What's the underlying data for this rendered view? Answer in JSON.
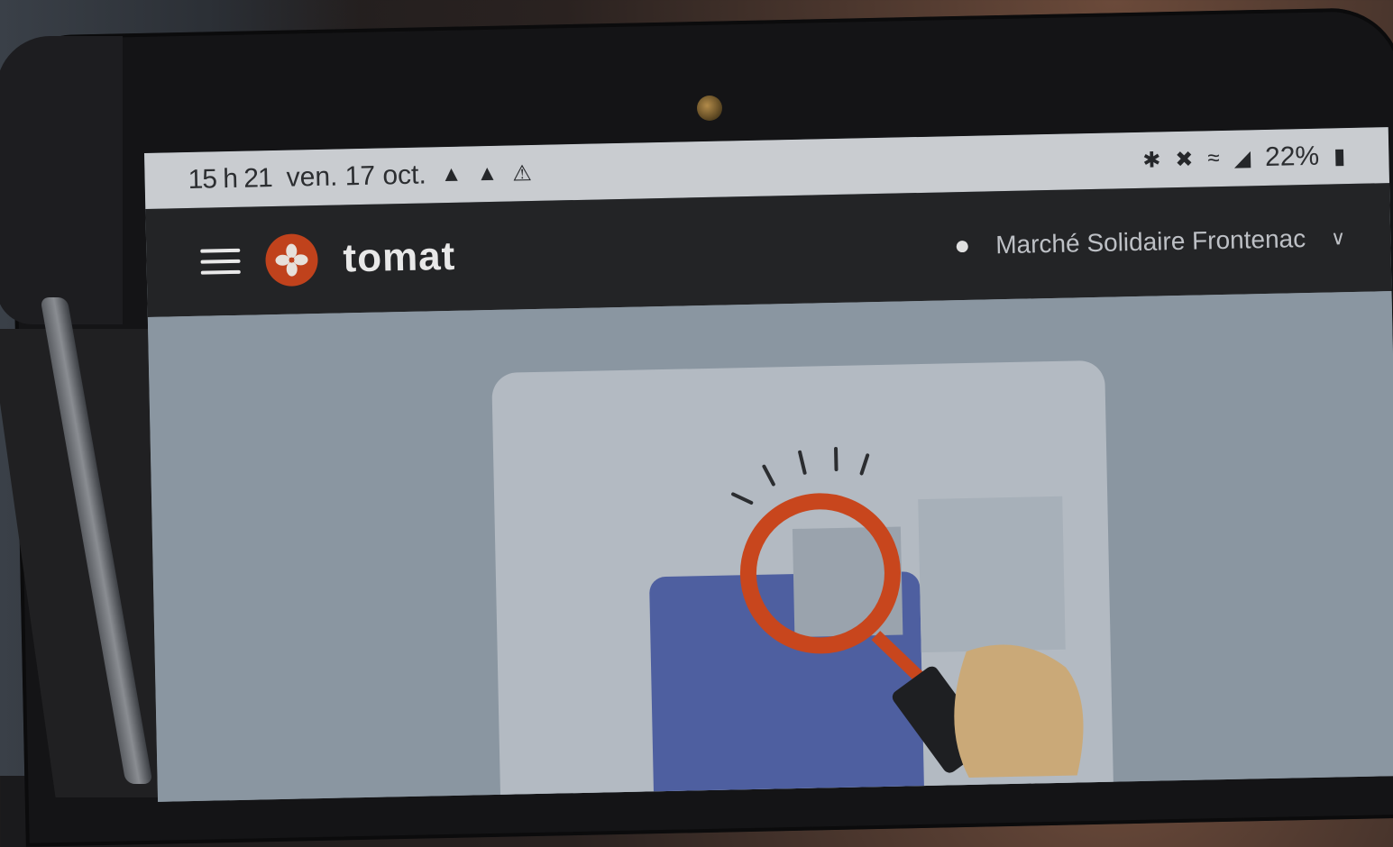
{
  "status_bar": {
    "time": "15 h 21",
    "date": "ven. 17 oct.",
    "battery": "22%"
  },
  "app_bar": {
    "logo_text": "tomat",
    "organization": "Marché Solidaire Frontenac"
  },
  "colors": {
    "brand": "#c0421c",
    "app_bar": "#232426",
    "content_bg": "#8a96a1"
  },
  "icons": {
    "menu": "hamburger-menu-icon",
    "user": "user-icon",
    "chevron": "chevron-down-icon"
  }
}
